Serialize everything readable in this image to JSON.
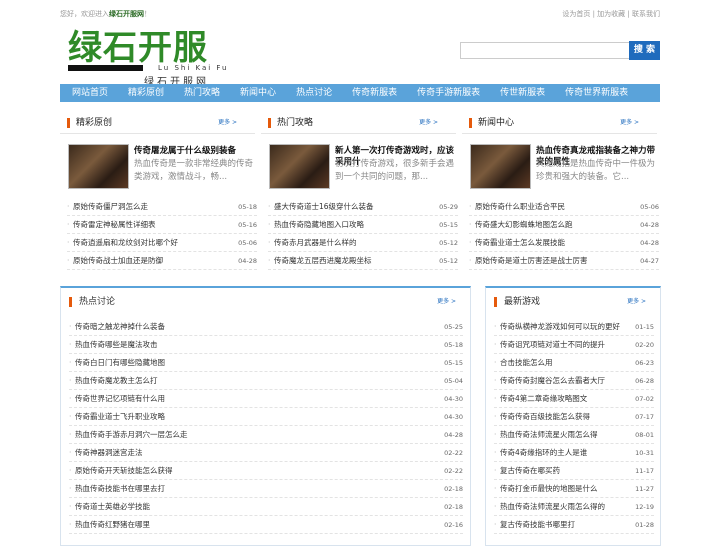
{
  "topbar": {
    "welcome_prefix": "您好，欢迎进入",
    "site_name": "绿石开服网",
    "welcome_suffix": "！",
    "links": "设为首页 | 加为收藏 | 联系我们"
  },
  "logo": {
    "cn": "绿石开服",
    "en": "Lu Shi Kai Fu",
    "cn2": "绿石开服网"
  },
  "search": {
    "button": "搜 索",
    "placeholder": ""
  },
  "nav": [
    "网站首页",
    "精彩原创",
    "热门攻略",
    "新闻中心",
    "热点讨论",
    "传奇新服表",
    "传奇手游新服表",
    "传世新服表",
    "传奇世界新服表"
  ],
  "sections": [
    {
      "title": "精彩原创",
      "more": "更多 >",
      "feature": {
        "title": "传奇屠龙属于什么级别装备",
        "desc": "热血传奇是一款非常经典的传奇类游戏，激情战斗，畅..."
      },
      "items": [
        [
          "原始传奇僵尸洞怎么走",
          "05-18"
        ],
        [
          "传奇雷定神秘属性详细表",
          "05-16"
        ],
        [
          "传奇逍遥扇和龙纹剑对比哪个好",
          "05-06"
        ],
        [
          "原始传奇战士加血还是防御",
          "04-28"
        ]
      ]
    },
    {
      "title": "热门攻略",
      "more": "更多 >",
      "feature": {
        "title": "新人第一次打传奇游戏时，应该采用什",
        "desc": "初次打传奇游戏，很多新手会遇到一个共同的问题，那..."
      },
      "items": [
        [
          "盛大传奇道士16级穿什么装备",
          "05-29"
        ],
        [
          "热血传奇隐藏地图入口攻略",
          "05-15"
        ],
        [
          "传奇赤月武器是什么样的",
          "05-12"
        ],
        [
          "传奇魔龙五层西进魔龙殿坐标",
          "05-12"
        ]
      ]
    },
    {
      "title": "新闻中心",
      "more": "更多 >",
      "feature": {
        "title": "热血传奇真龙戒指装备之神力带来的属性",
        "desc": "真龙戒指是热血传奇中一件极为珍贵和强大的装备。它..."
      },
      "items": [
        [
          "原始传奇什么职业适合平民",
          "05-06"
        ],
        [
          "传奇盛大幻影蜘蛛地图怎么跑",
          "04-28"
        ],
        [
          "传奇霸业道士怎么发展技能",
          "04-28"
        ],
        [
          "原始传奇是道士厉害还是战士厉害",
          "04-27"
        ]
      ]
    }
  ],
  "hot": {
    "title": "热点讨论",
    "more": "更多 >",
    "items": [
      [
        "传奇暗之触龙神掉什么装备",
        "05-25"
      ],
      [
        "热血传奇哪些是魔法攻击",
        "05-18"
      ],
      [
        "传奇白日门有哪些隐藏地图",
        "05-15"
      ],
      [
        "热血传奇魔龙教主怎么打",
        "05-04"
      ],
      [
        "传奇世界记忆项链有什么用",
        "04-30"
      ],
      [
        "传奇霸业道士飞升职业攻略",
        "04-30"
      ],
      [
        "热血传奇手游赤月洞穴一层怎么走",
        "04-28"
      ],
      [
        "传奇神器洞迷宫走法",
        "02-22"
      ],
      [
        "原始传奇开天斩技能怎么获得",
        "02-22"
      ],
      [
        "热血传奇技能书在哪里去打",
        "02-18"
      ],
      [
        "传奇道士英雄必学技能",
        "02-18"
      ],
      [
        "热血传奇红野猪在哪里",
        "02-16"
      ]
    ]
  },
  "games": {
    "title": "最新游戏",
    "more": "更多 >",
    "items": [
      [
        "传奇纵横神龙游戏如何可以玩的更好",
        "01-15"
      ],
      [
        "传奇诅咒项链对道士不同的提升",
        "02-20"
      ],
      [
        "合击技能怎么用",
        "06-23"
      ],
      [
        "传奇传奇封魔谷怎么去霸者大厅",
        "06-28"
      ],
      [
        "传奇4第二章奇缘攻略图文",
        "07-02"
      ],
      [
        "传奇传奇百级技能怎么获得",
        "07-17"
      ],
      [
        "热血传奇法师流星火雨怎么得",
        "08-01"
      ],
      [
        "传奇4奇缘指环的主人是谁",
        "10-31"
      ],
      [
        "复古传奇在哪买药",
        "11-17"
      ],
      [
        "传奇打金币最快的地图是什么",
        "11-27"
      ],
      [
        "热血传奇法师流星火雨怎么得的",
        "12-19"
      ],
      [
        "复古传奇技能书哪里打",
        "01-28"
      ]
    ]
  }
}
